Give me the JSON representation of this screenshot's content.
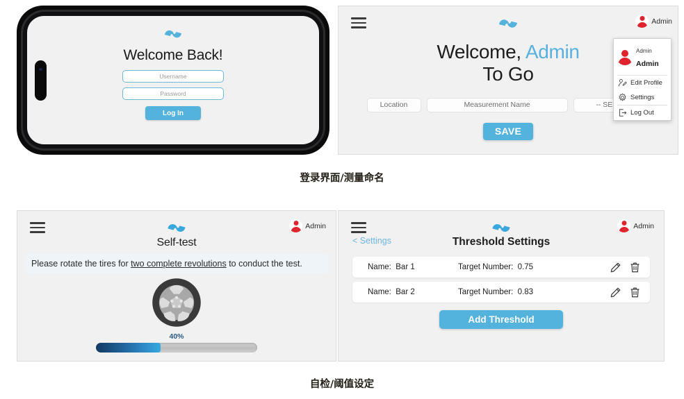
{
  "login_phone": {
    "logo_icon": "sync-arrows-logo",
    "title": "Welcome Back!",
    "username_placeholder": "Username",
    "password_placeholder": "Password",
    "login_button": "Log In"
  },
  "measurement_panel": {
    "menu_icon": "hamburger-menu-icon",
    "logo_icon": "sync-arrows-logo",
    "user_chip": {
      "avatar_icon": "user-avatar-icon",
      "name": "Admin"
    },
    "welcome_prefix": "Welcome, ",
    "welcome_user": "Admin",
    "welcome_line2": "To Go",
    "fields": {
      "location_placeholder": "Location",
      "measurement_placeholder": "Measurement Name",
      "select_placeholder": "-- SELEC"
    },
    "save_button": "SAVE",
    "dropdown": {
      "avatar_icon": "user-avatar-icon",
      "role": "Admin",
      "username": "Admin",
      "items": [
        {
          "label": "Edit Profile",
          "icon": "edit-profile-icon"
        },
        {
          "label": "Settings",
          "icon": "gear-icon"
        },
        {
          "label": "Log Out",
          "icon": "logout-icon"
        }
      ]
    }
  },
  "caption_top": "登录界面/测量命名",
  "caption_bottom": "自检/阈值设定",
  "selftest_panel": {
    "menu_icon": "hamburger-menu-icon",
    "logo_icon": "sync-arrows-logo",
    "user_chip": {
      "avatar_icon": "user-avatar-icon",
      "name": "Admin"
    },
    "title": "Self-test",
    "instruction_before": "Please rotate the tires for ",
    "instruction_emphasis": "two complete revolutions",
    "instruction_after": " to conduct the test.",
    "tire_icon": "tire-wheel-icon",
    "progress_label": "40%",
    "progress_value": 40
  },
  "threshold_panel": {
    "menu_icon": "hamburger-menu-icon",
    "logo_icon": "sync-arrows-logo",
    "user_chip": {
      "avatar_icon": "user-avatar-icon",
      "name": "Admin"
    },
    "back_link": "< Settings",
    "title": "Threshold Settings",
    "name_label": "Name:",
    "target_label": "Target Number:",
    "rows": [
      {
        "name": "Bar 1",
        "target": "0.75",
        "edit_icon": "pencil-icon",
        "delete_icon": "trash-icon"
      },
      {
        "name": "Bar 2",
        "target": "0.83",
        "edit_icon": "pencil-icon",
        "delete_icon": "trash-icon"
      }
    ],
    "add_button": "Add Threshold"
  },
  "colors": {
    "accent_blue": "#54b3dd",
    "light_blue_text": "#6fb6e0",
    "avatar_red": "#e0242e",
    "panel_bg": "#f1f1f1",
    "progress_dark": "#123a63",
    "progress_light": "#36a8e0"
  }
}
